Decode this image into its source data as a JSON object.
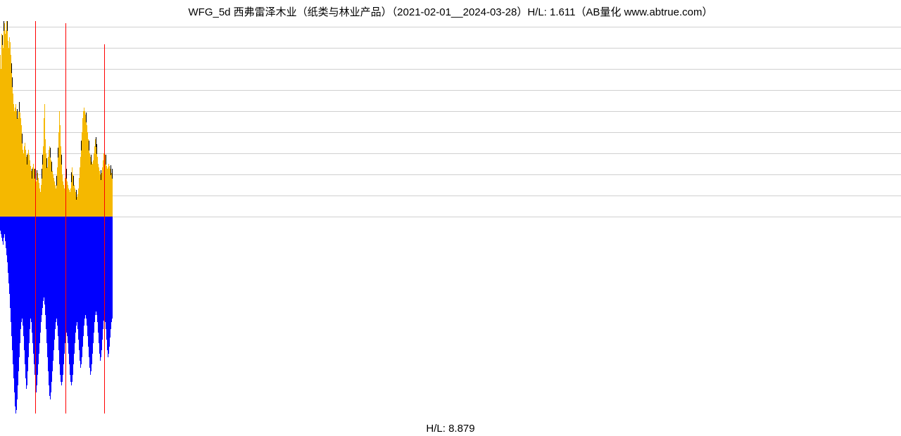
{
  "title": "WFG_5d 西弗雷泽木业（纸类与林业产品）（2021-02-01__2024-03-28）H/L: 1.611（AB量化  www.abtrue.com）",
  "footer": "H/L: 8.879",
  "chart_data": {
    "type": "bar",
    "title": "WFG_5d 西弗雷泽木业（纸类与林业产品）（2021-02-01__2024-03-28）H/L: 1.611",
    "xlabel": "",
    "ylabel": "",
    "baseline": 280,
    "grid_y": [
      10,
      40,
      70,
      100,
      130,
      160,
      190,
      220,
      250,
      280
    ],
    "series": [
      {
        "name": "up",
        "color": "#f5b800"
      },
      {
        "name": "down",
        "color": "#0000ff"
      },
      {
        "name": "highlight",
        "color": "#ff0000"
      },
      {
        "name": "overlay",
        "color": "#000000"
      }
    ],
    "note": "Positive bars (yellow/orange) extend upward from baseline ~y=280; negative bars (blue) extend downward. Occasional red spikes and black overlay ticks appear among upper bars. Data concentrated in leftmost ~12% of x-range.",
    "up_values": [
      230,
      210,
      260,
      250,
      240,
      270,
      275,
      260,
      265,
      278,
      270,
      250,
      240,
      255,
      248,
      230,
      210,
      190,
      175,
      160,
      150,
      155,
      160,
      150,
      145,
      140,
      150,
      155,
      148,
      140,
      130,
      110,
      95,
      90,
      100,
      105,
      95,
      85,
      80,
      90,
      95,
      88,
      80,
      72,
      65,
      60,
      70,
      75,
      68,
      60,
      55,
      50,
      58,
      62,
      55,
      48,
      40,
      35,
      45,
      60,
      80,
      100,
      140,
      160,
      110,
      90,
      75,
      70,
      85,
      95,
      100,
      90,
      80,
      70,
      65,
      60,
      55,
      50,
      45,
      40,
      50,
      70,
      90,
      120,
      150,
      130,
      100,
      80,
      60,
      50,
      45,
      40,
      55,
      70,
      60,
      50,
      45,
      40,
      38,
      35,
      40,
      55,
      70,
      60,
      50,
      45,
      40,
      35,
      30,
      28,
      32,
      40,
      55,
      70,
      85,
      100,
      120,
      140,
      150,
      155,
      150,
      145,
      140,
      130,
      120,
      110,
      100,
      90,
      85,
      80,
      78,
      75,
      80,
      90,
      100,
      110,
      105,
      95,
      85,
      75,
      70,
      65,
      60,
      58,
      62,
      70,
      80,
      90,
      95,
      88,
      80,
      72,
      68,
      70,
      75,
      72,
      68,
      65,
      62,
      60
    ],
    "down_values": [
      20,
      25,
      30,
      35,
      40,
      30,
      25,
      35,
      45,
      55,
      65,
      80,
      95,
      110,
      130,
      150,
      170,
      190,
      210,
      230,
      250,
      270,
      280,
      275,
      260,
      240,
      220,
      200,
      180,
      160,
      150,
      145,
      155,
      170,
      190,
      210,
      230,
      245,
      240,
      220,
      200,
      180,
      160,
      145,
      150,
      165,
      180,
      195,
      210,
      225,
      240,
      250,
      240,
      225,
      210,
      195,
      180,
      165,
      150,
      140,
      130,
      120,
      115,
      125,
      140,
      160,
      180,
      200,
      220,
      240,
      255,
      260,
      250,
      235,
      220,
      205,
      190,
      175,
      160,
      150,
      145,
      155,
      170,
      190,
      210,
      225,
      235,
      240,
      235,
      225,
      210,
      195,
      180,
      170,
      165,
      170,
      180,
      195,
      210,
      225,
      235,
      240,
      235,
      225,
      210,
      195,
      180,
      165,
      155,
      150,
      160,
      175,
      190,
      205,
      215,
      210,
      200,
      185,
      170,
      155,
      145,
      140,
      145,
      155,
      170,
      185,
      200,
      215,
      225,
      220,
      210,
      195,
      180,
      165,
      150,
      140,
      135,
      140,
      150,
      165,
      180,
      195,
      205,
      200,
      190,
      175,
      160,
      148,
      145,
      150,
      160,
      175,
      190,
      200,
      195,
      185,
      172,
      160,
      150,
      145
    ],
    "red_indices": [
      50,
      93,
      148
    ],
    "red_heights": [
      278,
      275,
      245
    ]
  }
}
